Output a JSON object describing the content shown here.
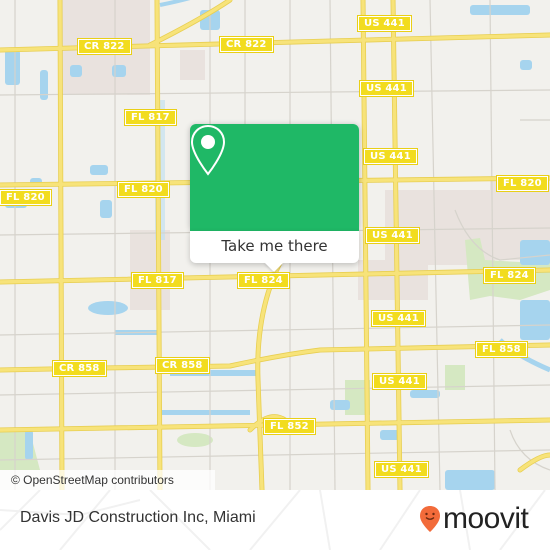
{
  "map": {
    "attribution": "© OpenStreetMap contributors",
    "colors": {
      "land": "#f2f1ed",
      "road_major": "#f7e37a",
      "road_major_casing": "#e8cf52",
      "road_minor": "#d6d3cc",
      "water": "#a6d4ee",
      "park": "#d5e8c2",
      "urban": "#e9e2de",
      "shield_fill": "#f2dc1f"
    },
    "road_labels": [
      {
        "id": "cr822-a",
        "text": "CR 822"
      },
      {
        "id": "cr822-b",
        "text": "CR 822"
      },
      {
        "id": "us441-a",
        "text": "US 441"
      },
      {
        "id": "us441-b",
        "text": "US 441"
      },
      {
        "id": "fl817-a",
        "text": "FL 817"
      },
      {
        "id": "us441-c",
        "text": "US 441"
      },
      {
        "id": "fl820-a",
        "text": "FL 820"
      },
      {
        "id": "fl820-b",
        "text": "FL 820"
      },
      {
        "id": "fl820-c",
        "text": "FL 820"
      },
      {
        "id": "us441-d",
        "text": "US 441"
      },
      {
        "id": "fl817-b",
        "text": "FL 817"
      },
      {
        "id": "fl824-a",
        "text": "FL 824"
      },
      {
        "id": "fl824-b",
        "text": "FL 824"
      },
      {
        "id": "us441-e",
        "text": "US 441"
      },
      {
        "id": "fl858",
        "text": "FL 858"
      },
      {
        "id": "cr858-a",
        "text": "CR 858"
      },
      {
        "id": "cr858-b",
        "text": "CR 858"
      },
      {
        "id": "us441-f",
        "text": "US 441"
      },
      {
        "id": "fl852",
        "text": "FL 852"
      },
      {
        "id": "us441-g",
        "text": "US 441"
      }
    ]
  },
  "popup": {
    "button_label": "Take me there",
    "icon": "map-pin-icon",
    "accent_color": "#1fb866"
  },
  "footer": {
    "place_name": "Davis JD Construction Inc, Miami",
    "brand": "moovit",
    "brand_icon": "moovit-smiley-pin-icon",
    "brand_color": "#f26b3a"
  }
}
